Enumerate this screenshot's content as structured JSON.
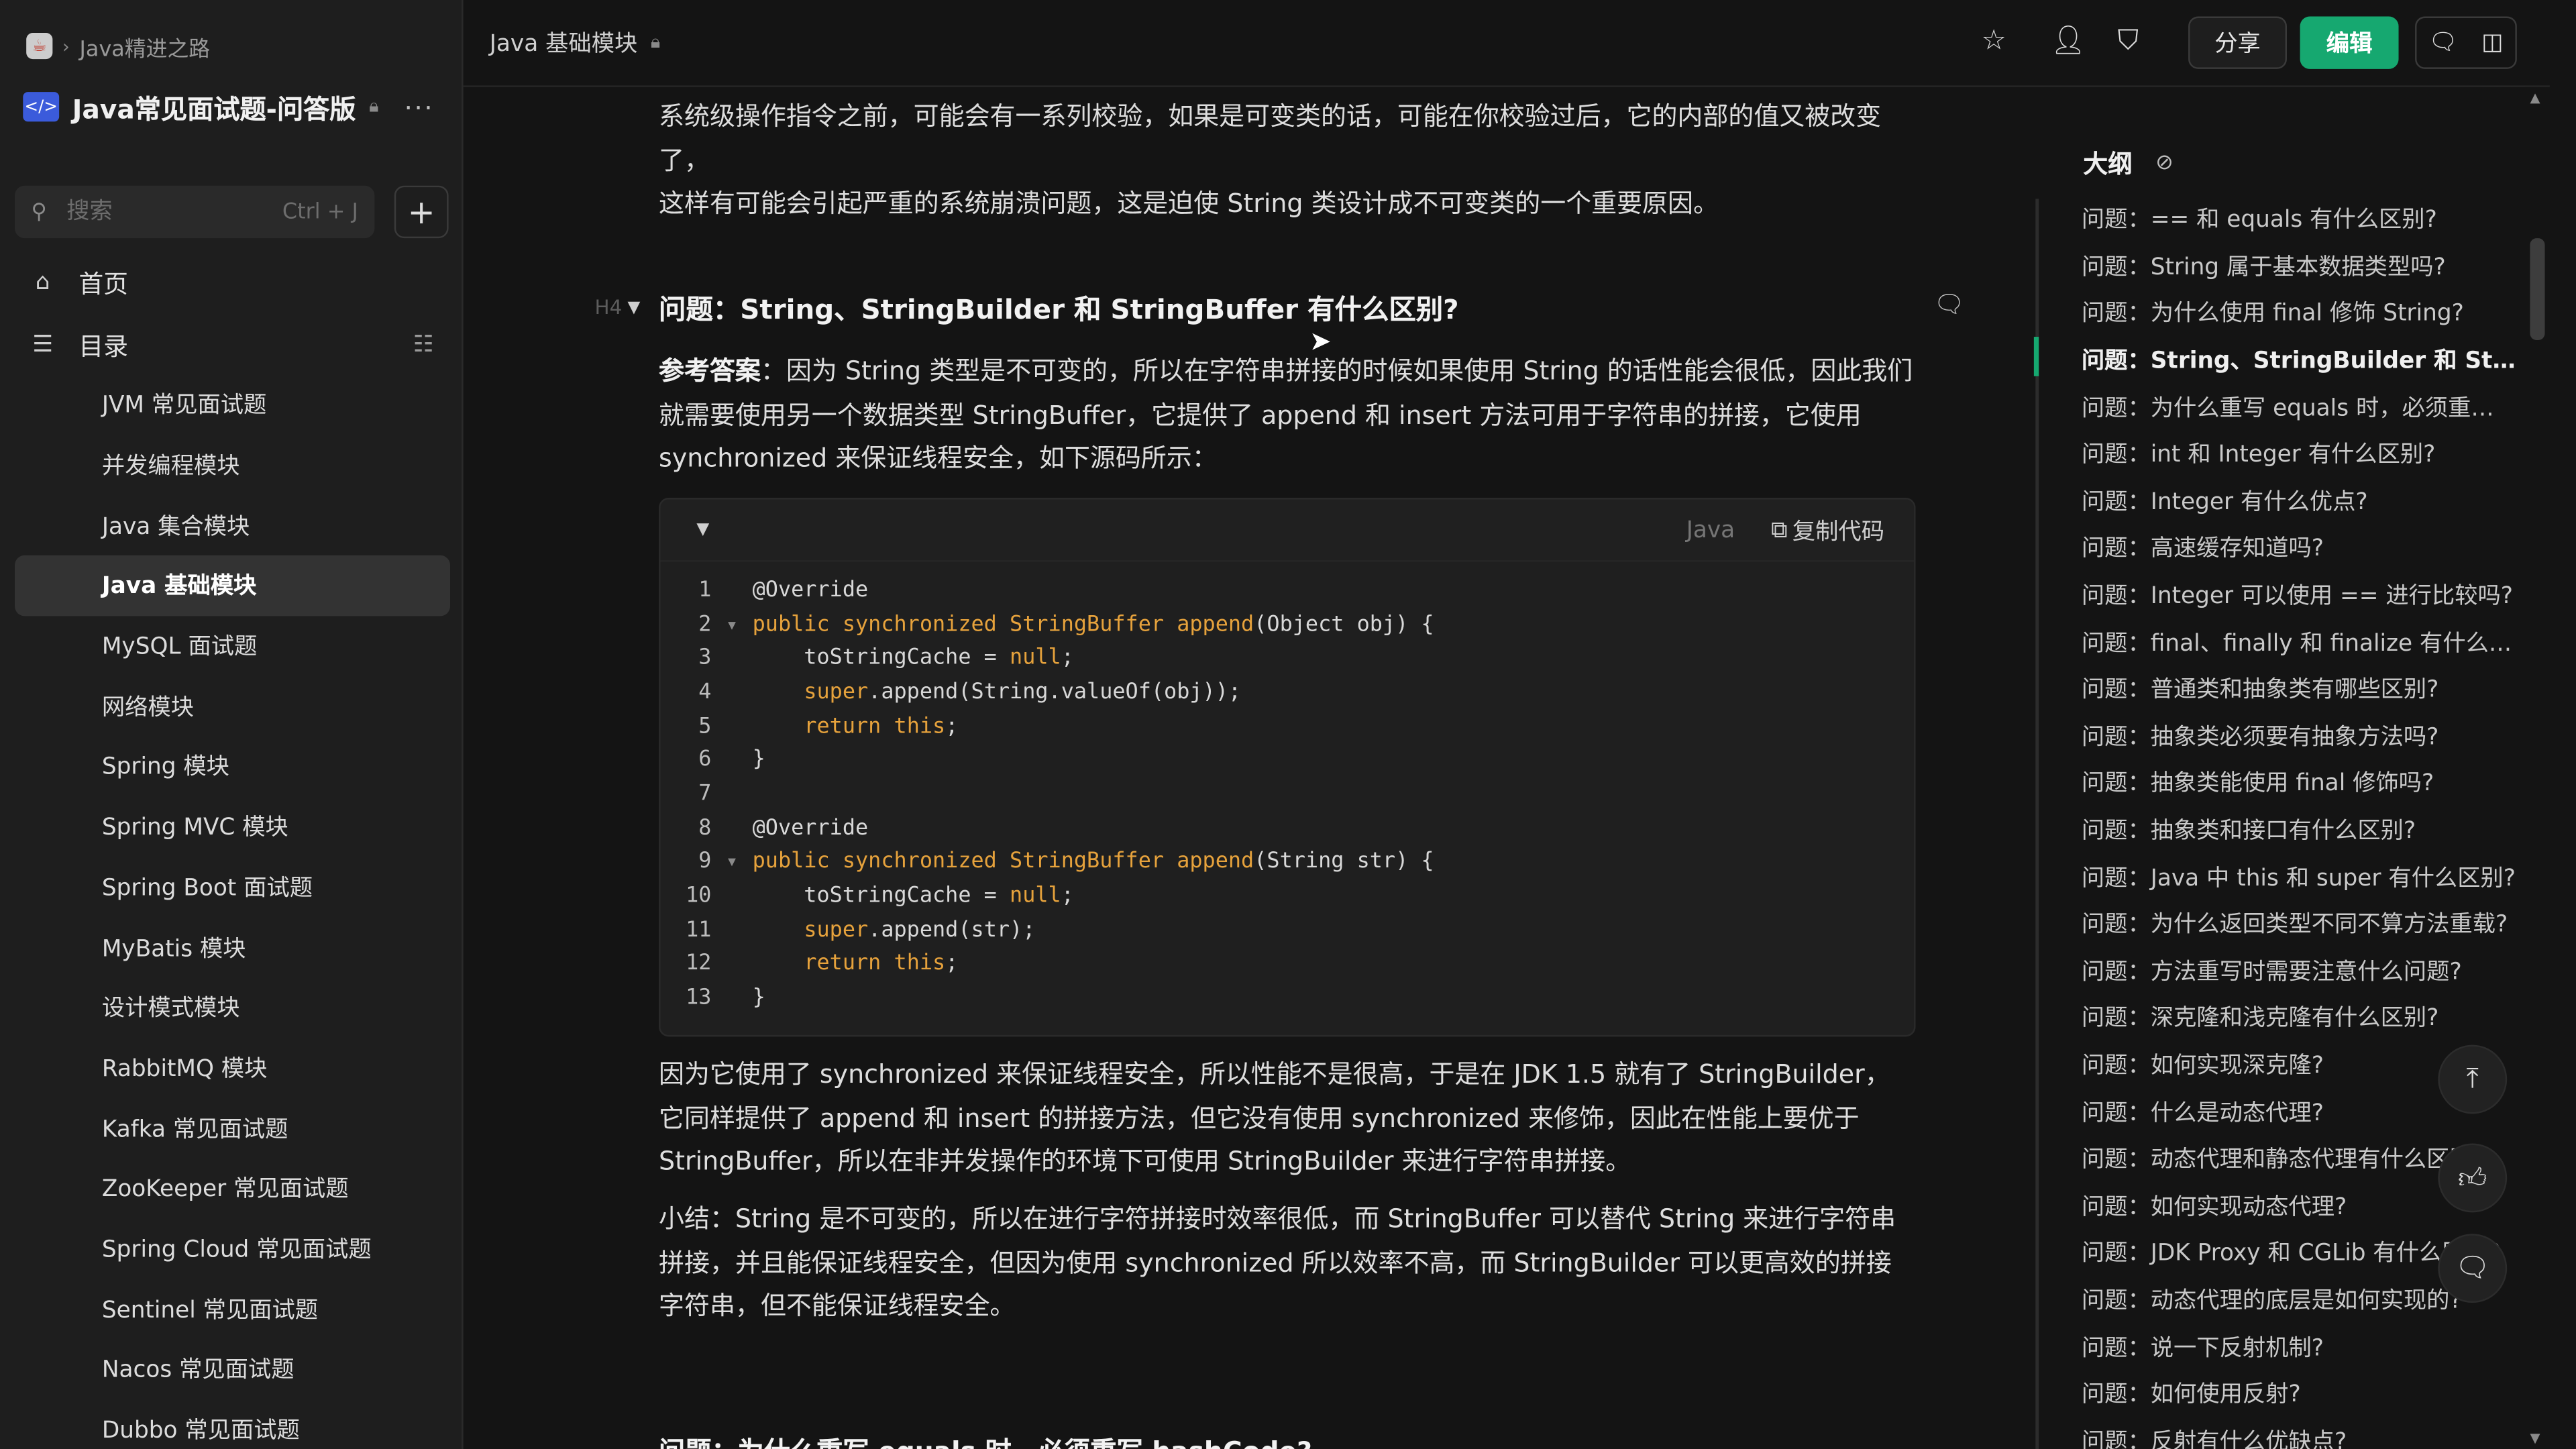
{
  "breadcrumb": {
    "root": "Java精进之路"
  },
  "knowledge_base": {
    "title": "Java常见面试题-问答版"
  },
  "search": {
    "placeholder": "搜索",
    "shortcut": "Ctrl + J"
  },
  "nav": {
    "home": "首页",
    "toc": "目录"
  },
  "directory": [
    "JVM 常见面试题",
    "并发编程模块",
    "Java 集合模块",
    "Java 基础模块",
    "MySQL 面试题",
    "网络模块",
    "Spring 模块",
    "Spring MVC 模块",
    "Spring Boot 面试题",
    "MyBatis 模块",
    "设计模式模块",
    "RabbitMQ 模块",
    "Kafka 常见面试题",
    "ZooKeeper 常见面试题",
    "Spring Cloud 常见面试题",
    "Sentinel 常见面试题",
    "Nacos 常见面试题",
    "Dubbo 常见面试题"
  ],
  "active_directory_index": 3,
  "header": {
    "doc_title": "Java 基础模块",
    "share_label": "分享",
    "edit_label": "编辑"
  },
  "content": {
    "intro_line1": "系统级操作指令之前，可能会有一系列校验，如果是可变类的话，可能在你校验过后，它的内部的值又被改变了，",
    "intro_line2": "这样有可能会引起严重的系统崩溃问题，这是迫使 String 类设计成不可变类的一个重要原因。",
    "heading_tag": "H4",
    "heading": "问题：String、StringBuilder 和 StringBuffer 有什么区别?",
    "answer_label": "参考答案",
    "answer_text": "：因为 String 类型是不可变的，所以在字符串拼接的时候如果使用 String 的话性能会很低，因此我们就需要使用另一个数据类型 StringBuffer，它提供了 append 和 insert 方法可用于字符串的拼接，它使用 synchronized 来保证线程安全，如下源码所示：",
    "code_lang": "Java",
    "code_copy": "复制代码",
    "code_lines": [
      "@Override",
      "public synchronized StringBuffer append(Object obj) {",
      "    toStringCache = null;",
      "    super.append(String.valueOf(obj));",
      "    return this;",
      "}",
      "",
      "@Override",
      "public synchronized StringBuffer append(String str) {",
      "    toStringCache = null;",
      "    super.append(str);",
      "    return this;",
      "}"
    ],
    "after_code": "因为它使用了 synchronized 来保证线程安全，所以性能不是很高，于是在 JDK 1.5 就有了 StringBuilder，它同样提供了 append 和 insert 的拼接方法，但它没有使用 synchronized 来修饰，因此在性能上要优于 StringBuffer，所以在非并发操作的环境下可使用 StringBuilder 来进行字符串拼接。",
    "summary": "小结：String 是不可变的，所以在进行字符拼接时效率很低，而 StringBuffer 可以替代 String 来进行字符串拼接，并且能保证线程安全，但因为使用 synchronized 所以效率不高，而 StringBuilder 可以更高效的拼接字符串，但不能保证线程安全。",
    "next_heading_partial": "问题：为什么重写 equals 时，必须重写 hashCode?"
  },
  "outline": {
    "title": "大纲",
    "active_index": 3,
    "items": [
      "问题：== 和 equals 有什么区别?",
      "问题：String 属于基本数据类型吗?",
      "问题：为什么使用 final 修饰 String?",
      "问题：String、StringBuilder 和 StringBuffer 有什么区别?",
      "问题：为什么重写 equals 时，必须重写 hashCode?",
      "问题：int 和 Integer 有什么区别?",
      "问题：Integer 有什么优点?",
      "问题：高速缓存知道吗?",
      "问题：Integer 可以使用 == 进行比较吗?",
      "问题：final、finally 和 finalize 有什么区别?",
      "问题：普通类和抽象类有哪些区别?",
      "问题：抽象类必须要有抽象方法吗?",
      "问题：抽象类能使用 final 修饰吗?",
      "问题：抽象类和接口有什么区别?",
      "问题：Java 中 this 和 super 有什么区别?",
      "问题：为什么返回类型不同不算方法重载?",
      "问题：方法重写时需要注意什么问题?",
      "问题：深克隆和浅克隆有什么区别?",
      "问题：如何实现深克隆?",
      "问题：什么是动态代理?",
      "问题：动态代理和静态代理有什么区别?",
      "问题：如何实现动态代理?",
      "问题：JDK Proxy 和 CGLib 有什么区别?",
      "问题：动态代理的底层是如何实现的?",
      "问题：说一下反射机制?",
      "问题：如何使用反射?",
      "问题：反射有什么优缺点?"
    ]
  }
}
